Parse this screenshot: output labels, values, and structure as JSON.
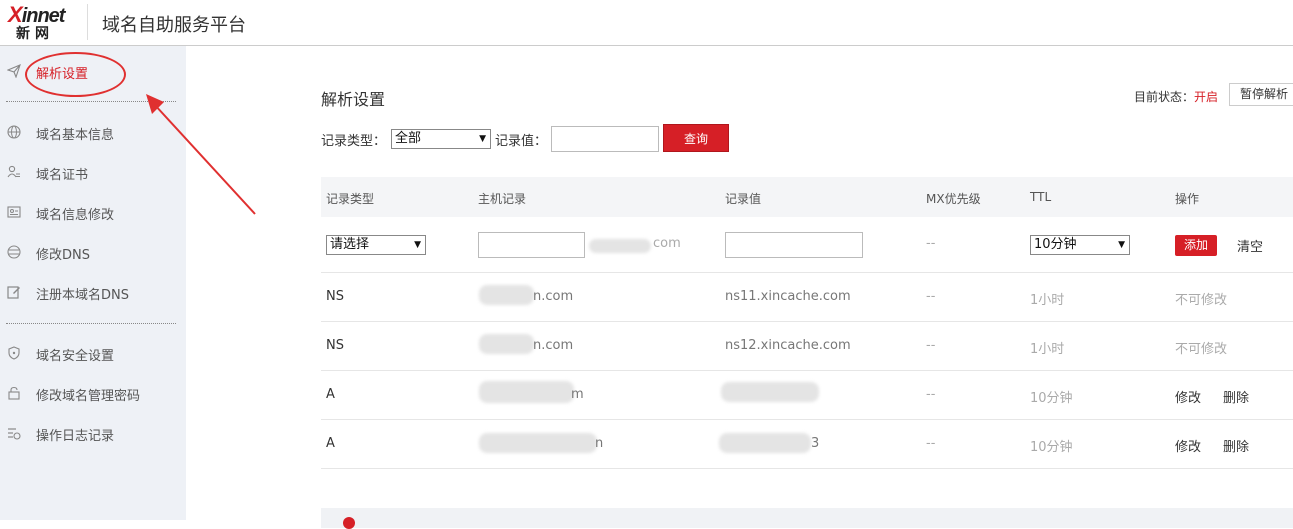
{
  "header": {
    "logo_top": "innet",
    "logo_x": "X",
    "logo_bottom": "新网",
    "title": "域名自助服务平台"
  },
  "sidebar": {
    "items": [
      {
        "label": "解析设置",
        "icon": "send-icon",
        "active": true
      },
      {
        "label": "域名基本信息",
        "icon": "globe-icon"
      },
      {
        "label": "域名证书",
        "icon": "user-certificate-icon"
      },
      {
        "label": "域名信息修改",
        "icon": "id-card-icon"
      },
      {
        "label": "修改DNS",
        "icon": "dns-globe-icon"
      },
      {
        "label": "注册本域名DNS",
        "icon": "edit-icon"
      },
      {
        "label": "域名安全设置",
        "icon": "shield-icon"
      },
      {
        "label": "修改域名管理密码",
        "icon": "lock-icon"
      },
      {
        "label": "操作日志记录",
        "icon": "log-list-icon"
      }
    ]
  },
  "main": {
    "title": "解析设置",
    "status_label": "目前状态：",
    "status_value": "开启",
    "pause_button": "暂停解析",
    "filter": {
      "type_label": "记录类型：",
      "type_value": "全部",
      "value_label": "记录值：",
      "value_input": "",
      "query_button": "查询"
    },
    "table": {
      "headers": [
        "记录类型",
        "主机记录",
        "记录值",
        "MX优先级",
        "TTL",
        "操作"
      ],
      "new_row": {
        "type_placeholder": "请选择",
        "host_suffix": "com",
        "mx": "--",
        "ttl": "10分钟",
        "add_button": "添加",
        "clear_button": "清空"
      },
      "rows": [
        {
          "type": "NS",
          "host": "n.com",
          "value": "ns11.xincache.com",
          "mx": "--",
          "ttl": "1小时",
          "action": "不可修改"
        },
        {
          "type": "NS",
          "host": "n.com",
          "value": "ns12.xincache.com",
          "mx": "--",
          "ttl": "1小时",
          "action": "不可修改"
        },
        {
          "type": "A",
          "host": "m",
          "value": "",
          "mx": "--",
          "ttl": "10分钟",
          "edit": "修改",
          "delete": "删除"
        },
        {
          "type": "A",
          "host": "n",
          "value": "3",
          "mx": "--",
          "ttl": "10分钟",
          "edit": "修改",
          "delete": "删除"
        }
      ]
    }
  },
  "colors": {
    "accent": "#d61f26",
    "sidebar_bg": "#eef1f6",
    "annotation": "#e03030"
  }
}
